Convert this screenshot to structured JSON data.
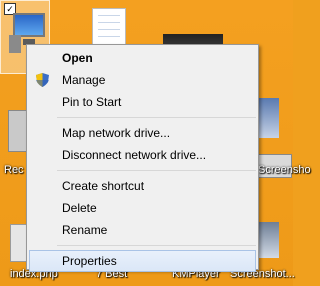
{
  "desktop": {
    "labels": {
      "left_partial_1": "Rec",
      "right_partial_1": "Screensho",
      "index": "index.php",
      "best": "7 Best",
      "kmplayer": "KMPlayer",
      "screenshot_bottom": "Screenshot..."
    }
  },
  "context_menu": {
    "items": [
      {
        "label": "Open"
      },
      {
        "label": "Manage"
      },
      {
        "label": "Pin to Start"
      },
      {
        "label": "Map network drive..."
      },
      {
        "label": "Disconnect network drive..."
      },
      {
        "label": "Create shortcut"
      },
      {
        "label": "Delete"
      },
      {
        "label": "Rename"
      },
      {
        "label": "Properties"
      }
    ]
  }
}
